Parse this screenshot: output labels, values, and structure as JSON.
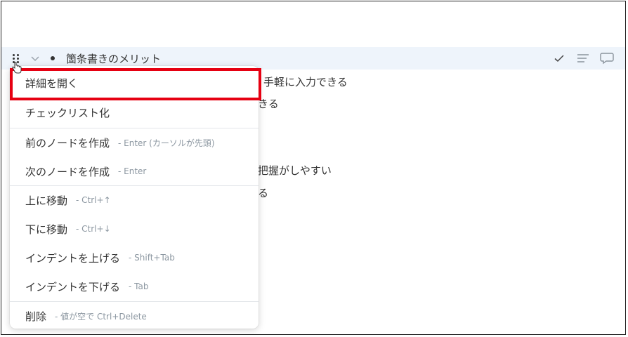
{
  "node": {
    "title": "箇条書きのメリット"
  },
  "background_lines": [
    "手軽に入力できる",
    "きる",
    "把握がしやすい",
    "る"
  ],
  "menu": {
    "items": [
      {
        "label": "詳細を開く",
        "shortcut": ""
      },
      {
        "label": "チェックリスト化",
        "shortcut": ""
      },
      {
        "label": "前のノードを作成",
        "shortcut": "- Enter (カーソルが先頭)"
      },
      {
        "label": "次のノードを作成",
        "shortcut": "- Enter"
      },
      {
        "label": "上に移動",
        "shortcut": "- Ctrl+↑"
      },
      {
        "label": "下に移動",
        "shortcut": "- Ctrl+↓"
      },
      {
        "label": "インデントを上げる",
        "shortcut": "- Shift+Tab"
      },
      {
        "label": "インデントを下げる",
        "shortcut": "- Tab"
      },
      {
        "label": "削除",
        "shortcut": "- 値が空で Ctrl+Delete"
      }
    ]
  },
  "icons": {
    "drag_handle": "drag-handle-icon",
    "collapse": "chevron-down-icon",
    "check": "check-icon",
    "note": "note-lines-icon",
    "comment": "comment-icon",
    "pointer": "hand-pointer-icon"
  },
  "colors": {
    "highlight": "#e60012",
    "row_background": "#eef4fb",
    "shortcut_text": "#8c97a1"
  }
}
